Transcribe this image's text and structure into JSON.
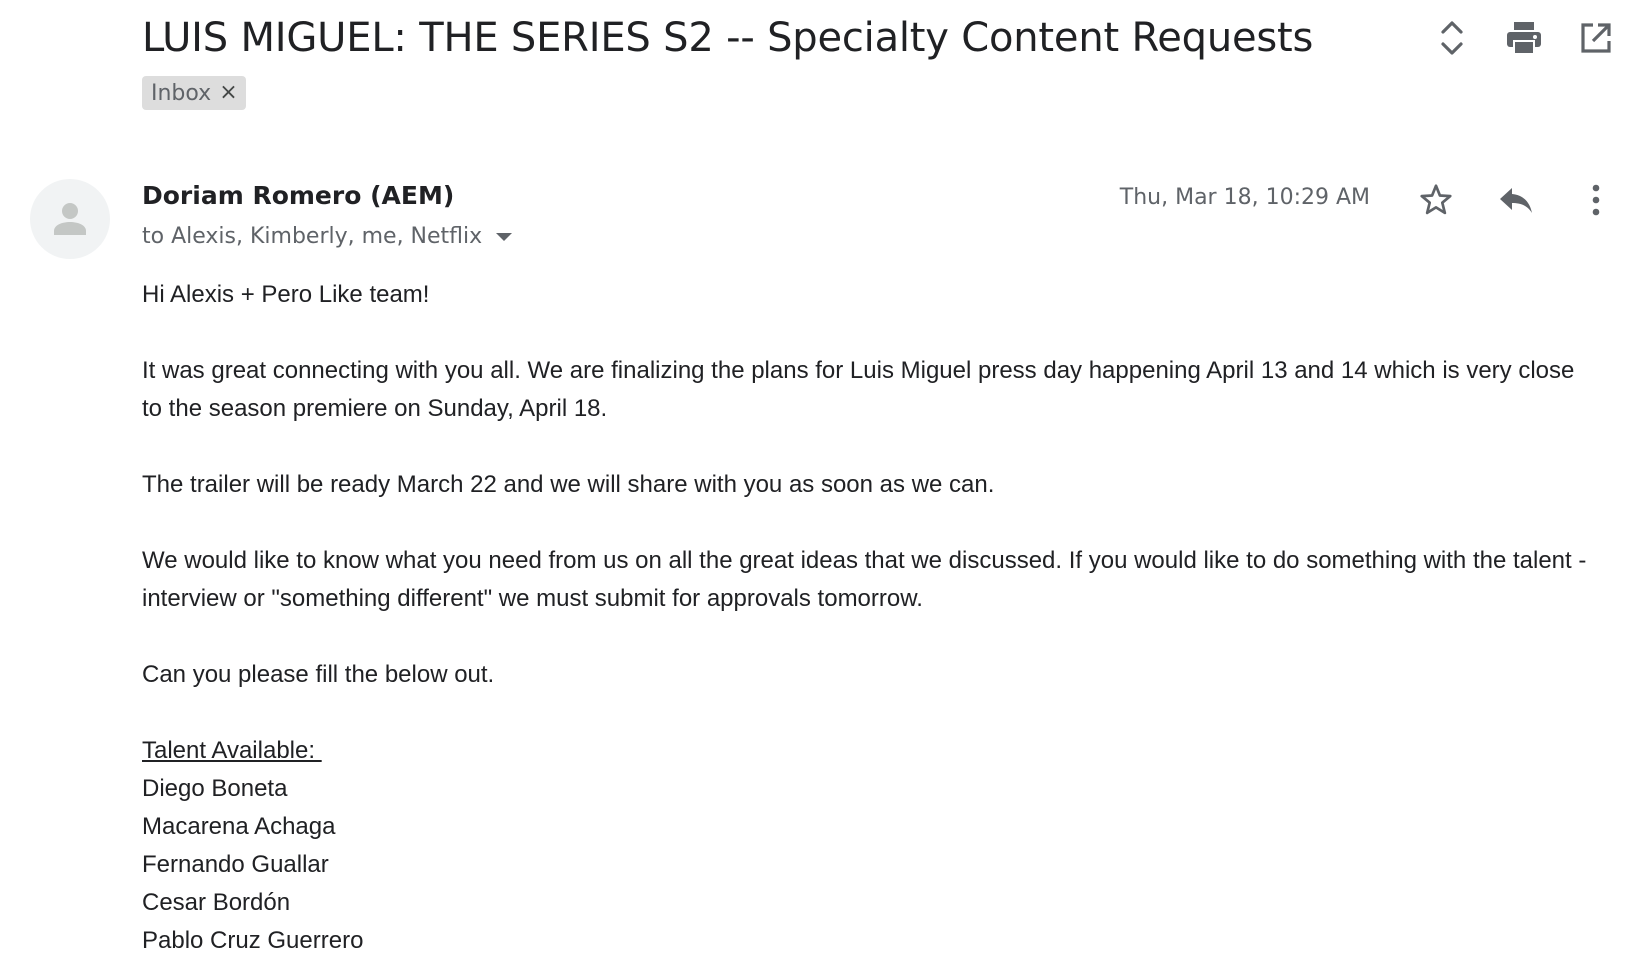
{
  "thread": {
    "subject": "LUIS MIGUEL: THE SERIES S2 -- Specialty Content Requests",
    "label": "Inbox",
    "label_remove": "×"
  },
  "icons": {
    "expand": "expand-collapse-icon",
    "print": "print-icon",
    "popout": "open-in-new-window-icon",
    "star": "star-icon",
    "reply": "reply-icon",
    "more": "more-vert-icon",
    "avatar": "person-icon",
    "caret": "caret-down-icon"
  },
  "message": {
    "sender": "Doriam Romero (AEM)",
    "recipients": "to Alexis, Kimberly, me, Netflix",
    "date": "Thu, Mar 18, 10:29 AM",
    "greeting": "Hi Alexis + Pero Like team!",
    "paragraphs": [
      "It was great connecting with you all. We are finalizing the plans for Luis Miguel press day happening April 13 and 14 which is very close to the season premiere on Sunday, April 18.",
      "The trailer will be ready March 22 and we will share with you as soon as we can.",
      "We would like to know what you need from us on all the great ideas that we discussed. If you would like to do something with the talent - interview or \"something different\" we must submit for approvals tomorrow.",
      "Can you please fill the below out."
    ],
    "talent_heading": "Talent Available: ",
    "talent": [
      "Diego Boneta",
      "Macarena Achaga",
      "Fernando Guallar",
      "Cesar Bordón",
      "Pablo Cruz Guerrero"
    ]
  },
  "colors": {
    "text": "#202124",
    "muted": "#5f6368",
    "chip_bg": "#dddddd",
    "icon": "#5f6368",
    "avatar_bg": "#f1f3f4",
    "avatar_fg": "#c4c7c5"
  }
}
